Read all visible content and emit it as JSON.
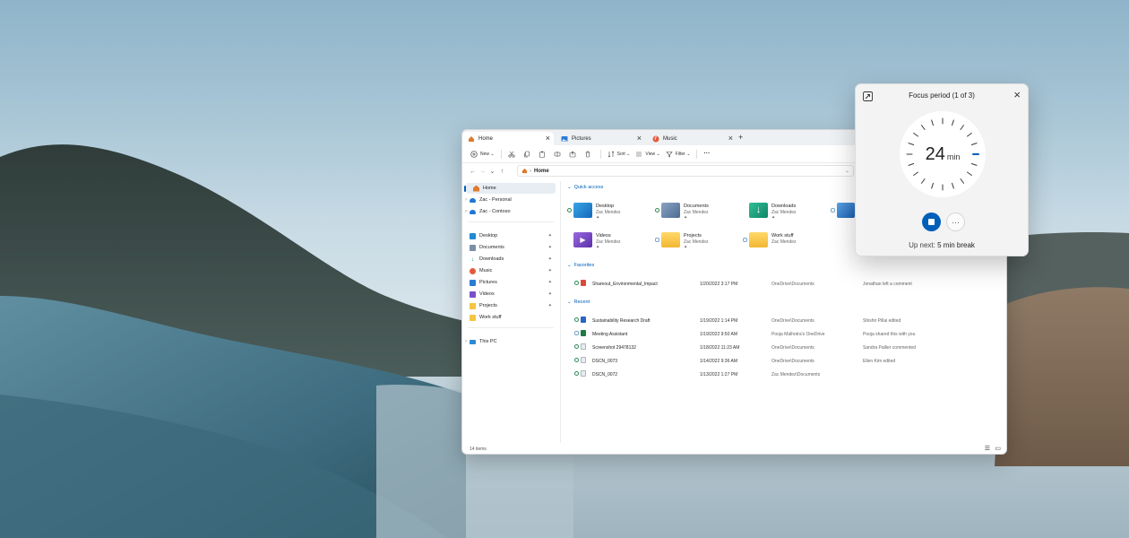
{
  "explorer": {
    "tabs": [
      {
        "label": "Home",
        "icon": "home-icon"
      },
      {
        "label": "Pictures",
        "icon": "pictures-icon"
      },
      {
        "label": "Music",
        "icon": "music-icon"
      }
    ],
    "toolbar": {
      "new_label": "New",
      "sort_label": "Sort",
      "view_label": "View",
      "filter_label": "Filter",
      "more_label": "···"
    },
    "address": {
      "crumb": "Home"
    },
    "sidebar": {
      "home": "Home",
      "personal": "Zac - Personal",
      "contoso": "Zac - Contoso",
      "pinned": [
        "Desktop",
        "Documents",
        "Downloads",
        "Music",
        "Pictures",
        "Videos",
        "Projects",
        "Work stuff"
      ],
      "this_pc": "This PC"
    },
    "quick_access": {
      "heading": "Quick access",
      "items": [
        {
          "name": "Desktop",
          "owner": "Zac Mendez",
          "color": "#1f8ad6"
        },
        {
          "name": "Documents",
          "owner": "Zac Mendez",
          "color": "#5a7ea8"
        },
        {
          "name": "Downloads",
          "owner": "Zac Mendez",
          "color": "#1aa37f"
        },
        {
          "name": "Videos",
          "owner": "Zac Mendez",
          "color": "#7b4fc9"
        },
        {
          "name": "Projects",
          "owner": "Zac Mendez",
          "color": "#f5c542"
        },
        {
          "name": "Work stuff",
          "owner": "Zac Mendez",
          "color": "#f5c542"
        }
      ]
    },
    "favorites": {
      "heading": "Favorites",
      "rows": [
        {
          "name": "Shareout_Environmental_Impact",
          "date": "1/20/2022 3:17 PM",
          "location": "OneDrive\\Documents",
          "activity": "Jonathan left a comment"
        }
      ]
    },
    "recent": {
      "heading": "Recent",
      "rows": [
        {
          "name": "Sustainability Research Draft",
          "date": "1/19/2022 1:14 PM",
          "location": "OneDrive\\Documents",
          "activity": "Shishir Pillai edited"
        },
        {
          "name": "Meeting Assistant",
          "date": "1/19/2022 9:50 AM",
          "location": "Pooja Malhotra's OneDrive",
          "activity": "Pooja shared this with you"
        },
        {
          "name": "Screenshot 29478132",
          "date": "1/18/2022 11:23 AM",
          "location": "OneDrive\\Documents",
          "activity": "Sandra Pallier commented"
        },
        {
          "name": "DSCN_0073",
          "date": "1/14/2022 9:36 AM",
          "location": "OneDrive\\Documents",
          "activity": "Ellen Kim edited"
        },
        {
          "name": "DSCN_0072",
          "date": "1/13/2022 1:27 PM",
          "location": "Zac Mendez\\Documents",
          "activity": ""
        }
      ]
    },
    "status": {
      "count": "14 items"
    }
  },
  "focus": {
    "title": "Focus period (1 of 3)",
    "minutes": "24",
    "unit": "min",
    "upnext_prefix": "Up next:",
    "upnext_value": "5 min break",
    "accent": "#005fb8"
  }
}
